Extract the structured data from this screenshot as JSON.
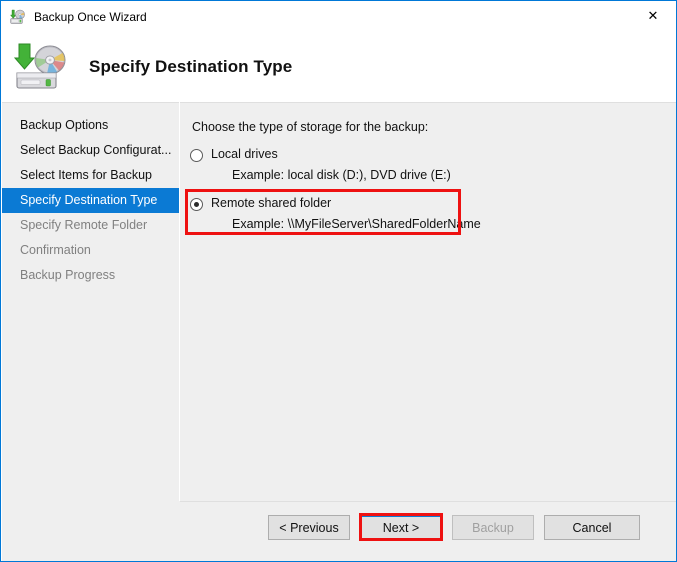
{
  "window": {
    "title": "Backup Once Wizard",
    "title_icon": "backup-disk-icon",
    "close_icon": "✕",
    "border_color": "#0078d7"
  },
  "header": {
    "title": "Specify Destination Type",
    "icon": "backup-drive-disc-icon"
  },
  "sidebar": {
    "items": [
      {
        "label": "Backup Options",
        "state": "done"
      },
      {
        "label": "Select Backup Configurat...",
        "state": "done"
      },
      {
        "label": "Select Items for Backup",
        "state": "done"
      },
      {
        "label": "Specify Destination Type",
        "state": "current"
      },
      {
        "label": "Specify Remote Folder",
        "state": "upcoming"
      },
      {
        "label": "Confirmation",
        "state": "upcoming"
      },
      {
        "label": "Backup Progress",
        "state": "upcoming"
      }
    ],
    "highlight_color": "#0b7ad4"
  },
  "content": {
    "prompt": "Choose the type of storage for the backup:",
    "options": [
      {
        "label": "Local drives",
        "example": "Example: local disk (D:), DVD drive (E:)",
        "selected": false
      },
      {
        "label": "Remote shared folder",
        "example": "Example: \\\\MyFileServer\\SharedFolderName",
        "selected": true
      }
    ]
  },
  "annotations": {
    "color": "#ee1111",
    "targets": [
      "remote-shared-folder-option",
      "next-button"
    ]
  },
  "footer": {
    "buttons": [
      {
        "label": "< Previous",
        "enabled": true,
        "focused": false
      },
      {
        "label": "Next >",
        "enabled": true,
        "focused": true
      },
      {
        "label": "Backup",
        "enabled": false,
        "focused": false
      },
      {
        "label": "Cancel",
        "enabled": true,
        "focused": false
      }
    ]
  }
}
